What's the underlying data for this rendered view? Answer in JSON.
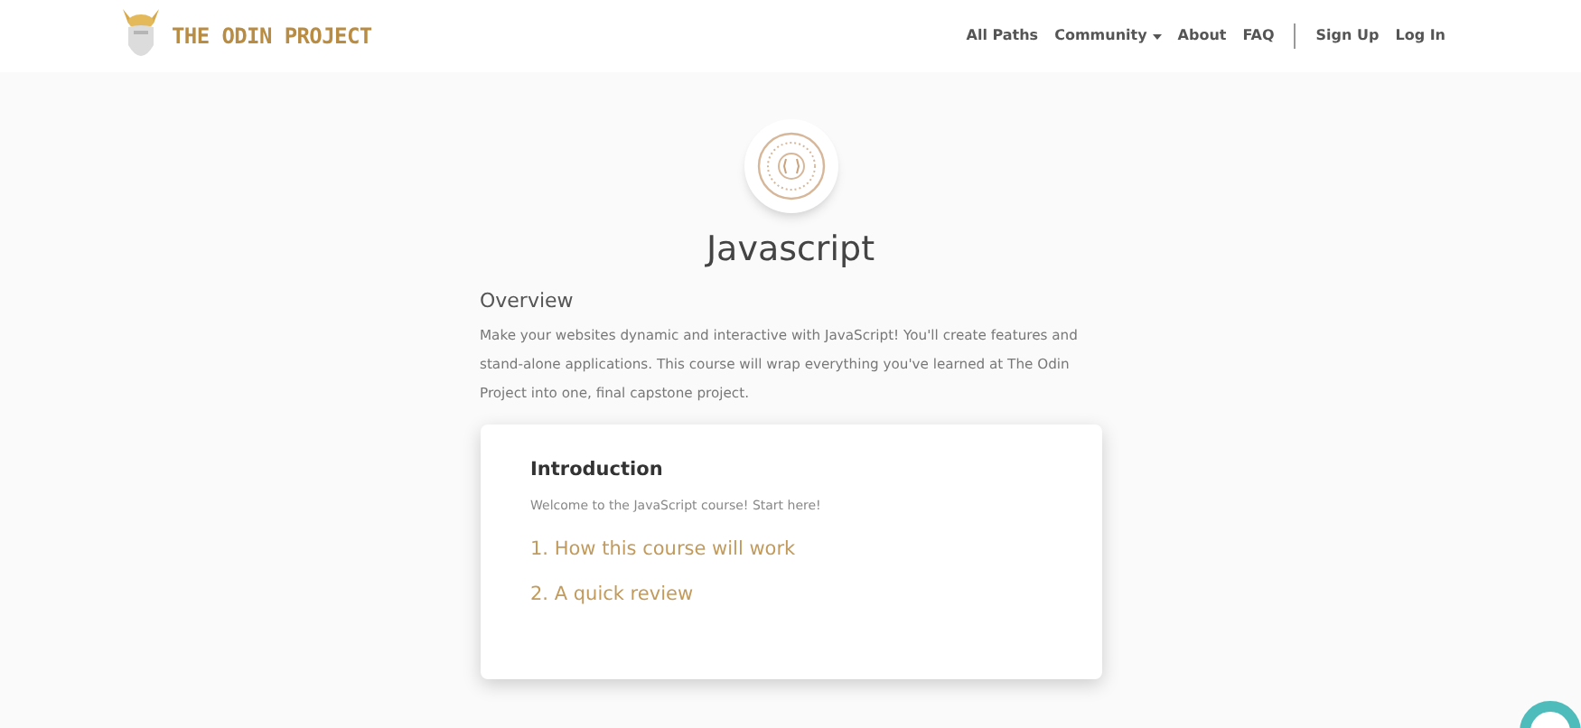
{
  "header": {
    "logo_text": "THE ODIN PROJECT",
    "nav": [
      {
        "label": "All Paths",
        "dropdown": false
      },
      {
        "label": "Community",
        "dropdown": true
      },
      {
        "label": "About",
        "dropdown": false
      },
      {
        "label": "FAQ",
        "dropdown": false
      }
    ],
    "auth": [
      "Sign Up",
      "Log In"
    ]
  },
  "course": {
    "title": "Javascript",
    "overview_heading": "Overview",
    "overview": "Make your websites dynamic and interactive with JavaScript! You'll create features and stand-alone applications. This course will wrap everything you've learned at The Odin Project into one, final capstone project."
  },
  "section": {
    "title": "Introduction",
    "description": "Welcome to the JavaScript course! Start here!",
    "lessons": [
      "1. How this course will work",
      "2. A quick review"
    ]
  }
}
